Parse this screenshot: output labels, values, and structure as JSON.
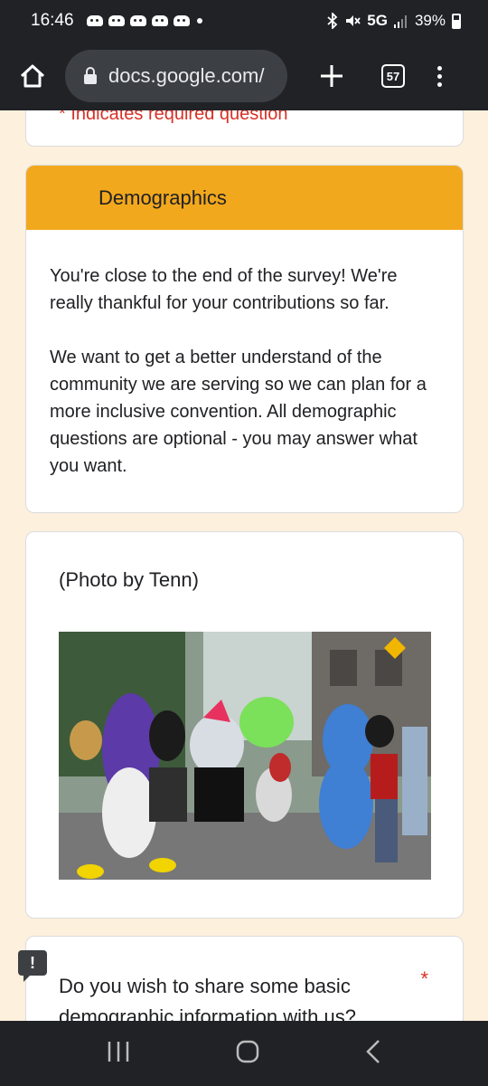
{
  "status_bar": {
    "time": "16:46",
    "network": "5G",
    "battery": "39%"
  },
  "browser": {
    "url": "docs.google.com/",
    "tab_count": "57"
  },
  "form": {
    "required_note": "* Indicates required question",
    "section": {
      "title": "Demographics",
      "header_color": "#f2a81d",
      "paragraph_1": "You're close to the end of the survey! We're really thankful for your contributions so far.",
      "paragraph_2": "We want to get a better understand of the community we are serving so we can plan for a more inclusive convention. All demographic questions are optional - you may answer what you want."
    },
    "photo": {
      "caption": "(Photo by Tenn)"
    },
    "question": {
      "text": "Do you wish to share some basic demographic information with us?",
      "required_mark": "*"
    }
  }
}
